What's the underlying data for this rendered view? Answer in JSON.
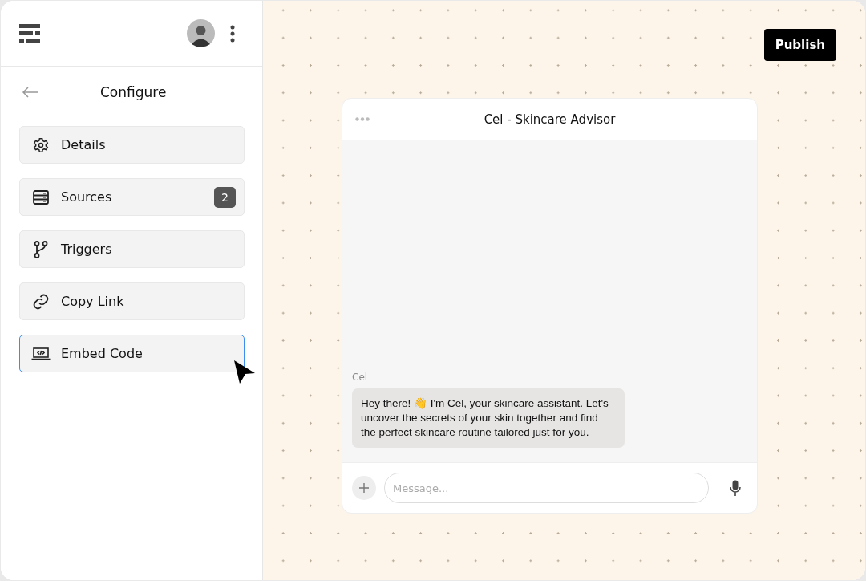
{
  "sidebar": {
    "title": "Configure",
    "items": [
      {
        "label": "Details",
        "selected": false
      },
      {
        "label": "Sources",
        "selected": false,
        "badge": "2"
      },
      {
        "label": "Triggers",
        "selected": false
      },
      {
        "label": "Copy Link",
        "selected": false
      },
      {
        "label": "Embed Code",
        "selected": true
      }
    ]
  },
  "publish_button": "Publish",
  "chat": {
    "title": "Cel - Skincare Advisor",
    "messages": [
      {
        "sender": "Cel",
        "text": "Hey there! 👋 I'm Cel, your skincare assistant. Let's uncover the secrets of your skin together and find the perfect skincare routine tailored just for you."
      }
    ],
    "input": {
      "placeholder": "Message..."
    }
  }
}
